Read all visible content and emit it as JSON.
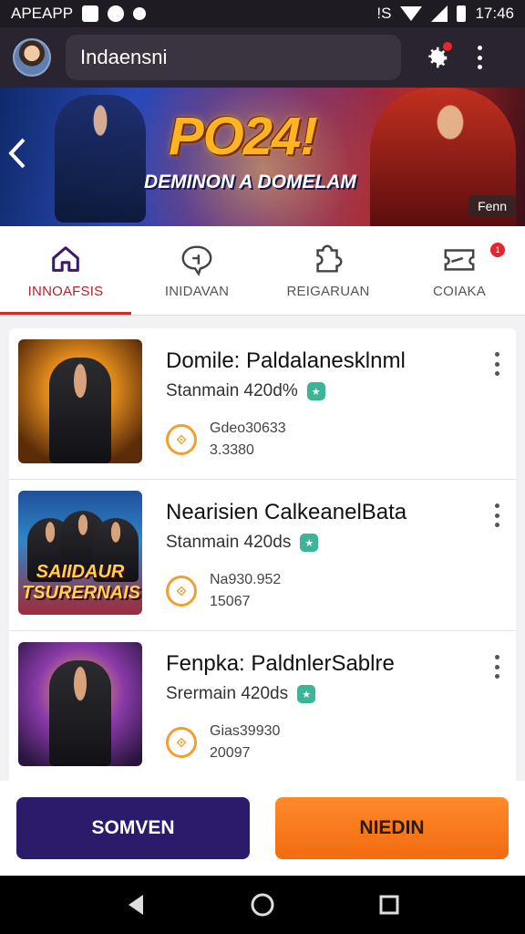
{
  "status_bar": {
    "app_name": "APEAPP",
    "network": "!S",
    "time": "17:46"
  },
  "header": {
    "search_text": "Indaensni"
  },
  "banner": {
    "title": "PO24!",
    "subtitle": "DEMINON A DOMELAM",
    "badge": "Fenn"
  },
  "tabs": [
    {
      "label": "INNOAFSIS",
      "icon": "home-icon",
      "active": true
    },
    {
      "label": "INIDAVAN",
      "icon": "chat-icon",
      "active": false
    },
    {
      "label": "REIGARUAN",
      "icon": "puzzle-icon",
      "active": false
    },
    {
      "label": "COIAKA",
      "icon": "ticket-icon",
      "active": false,
      "badge": "1"
    }
  ],
  "items": [
    {
      "name": "Domile: Paldalanesklnml",
      "meta": "Stanmain 420d%",
      "stat1": "Gdeo30633",
      "stat2": "3.3380",
      "thumb_text": ""
    },
    {
      "name": "Nearisien CalkeanelBata",
      "meta": "Stanmain 420ds",
      "stat1": "Na930.952",
      "stat2": "15067",
      "thumb_text": "SAIIDAUR TSURERNAIS"
    },
    {
      "name": "Fenpka: PaldnlerSablre",
      "meta": "Srermain 420ds",
      "stat1": "Gias39930",
      "stat2": "20097",
      "thumb_text": ""
    }
  ],
  "actions": {
    "left_label": "SOMVEN",
    "right_label": "NIEDIN"
  },
  "colors": {
    "primary": "#2c1a6b",
    "accent": "#f26b10",
    "active_tab": "#cf2c2c"
  }
}
